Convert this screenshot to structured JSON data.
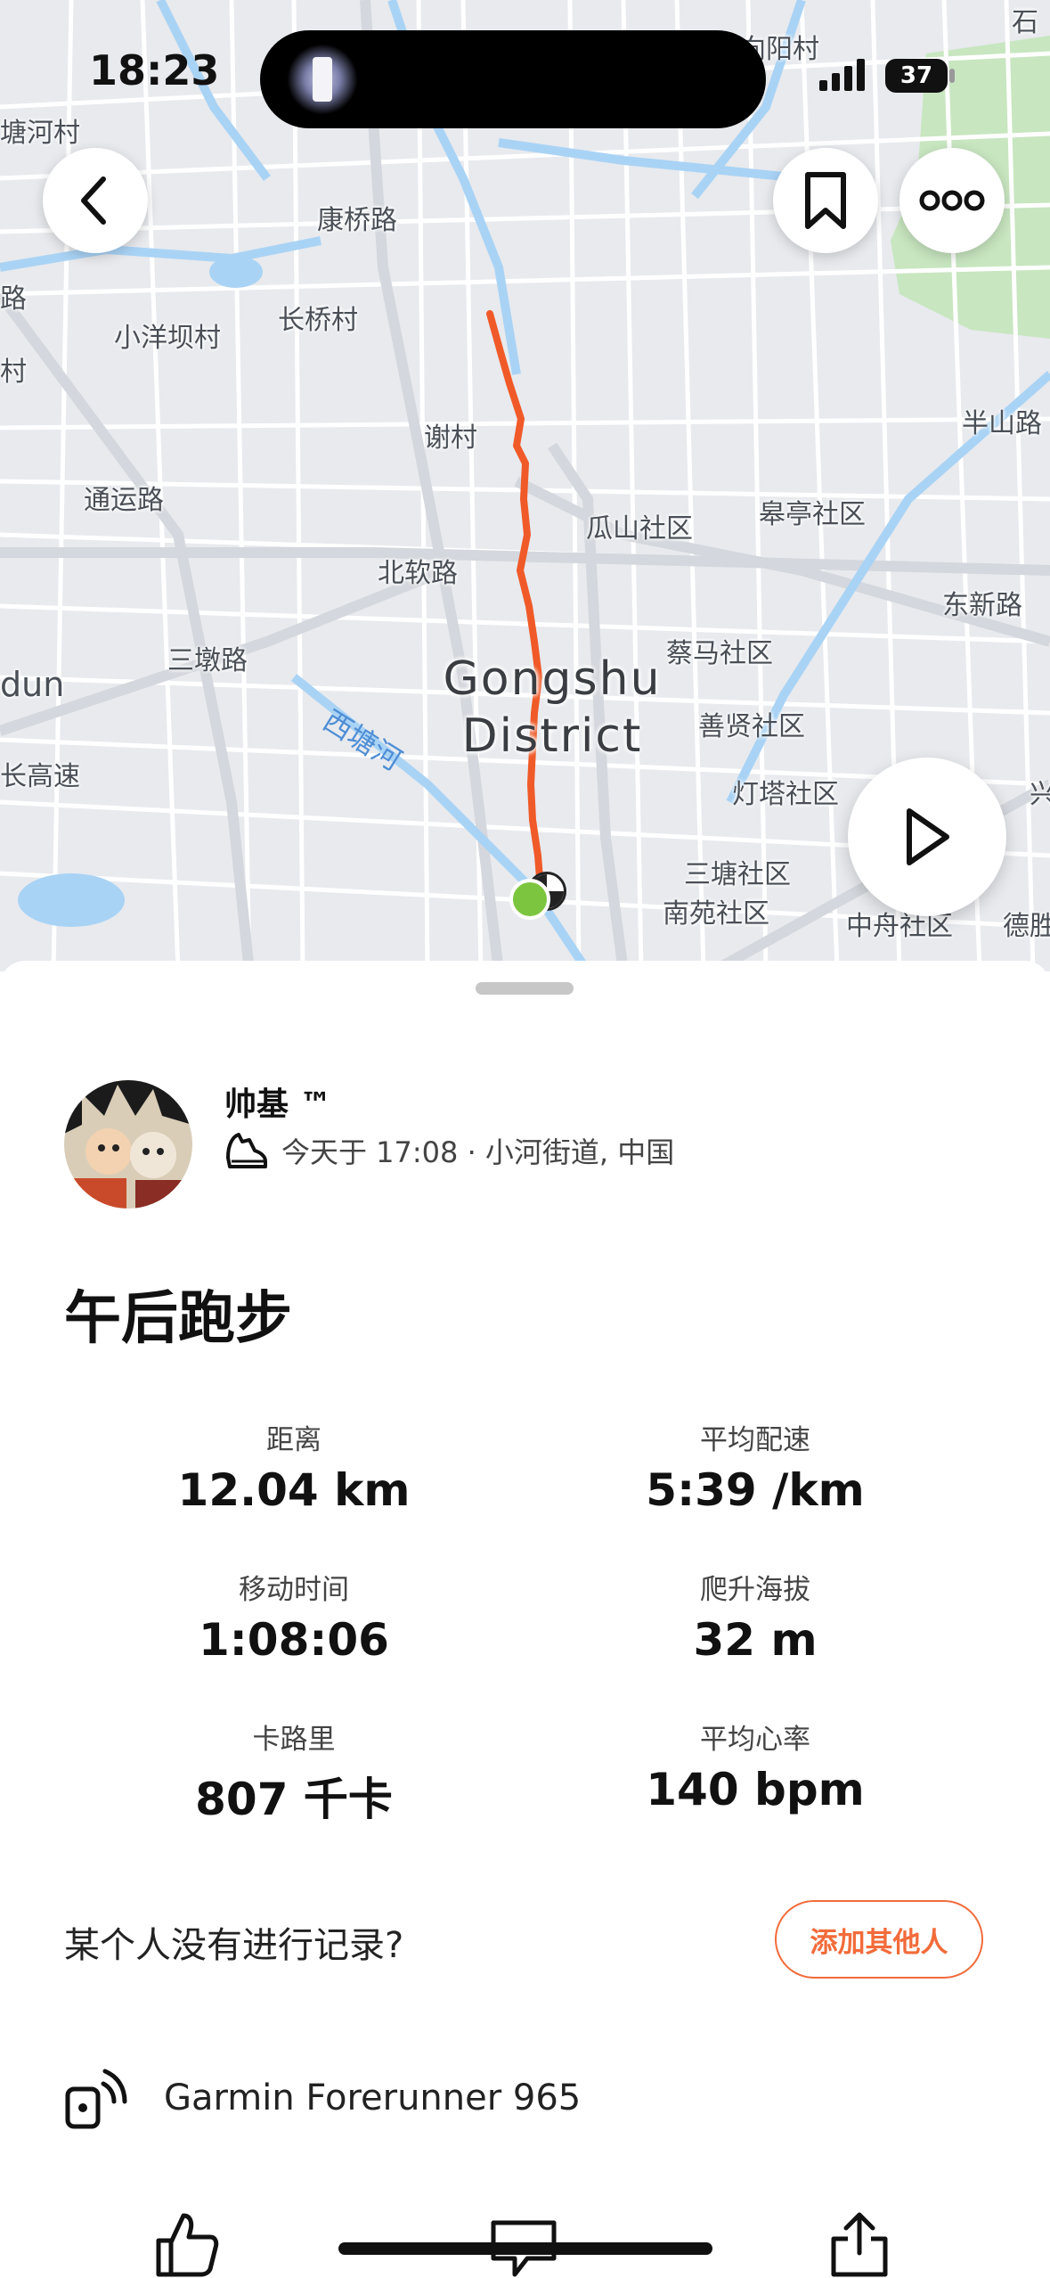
{
  "status_bar": {
    "time": "18:23",
    "battery": "37"
  },
  "map": {
    "labels": {
      "chaoyang": "向阳村",
      "tanghecun": "塘河村",
      "kangqiaolu": "康桥路",
      "lu_left": "路",
      "xiaoyangbacun": "小洋坝村",
      "changqiaocun": "长桥村",
      "cun_left": "村",
      "banshan": "半山路",
      "xiecun": "谢村",
      "tongyunlu": "通运路",
      "guashan": "瓜山社区",
      "gaoting": "皋亭社区",
      "beiruanlu": "北软路",
      "dongxinlu": "东新路",
      "sandunlu": "三墩路",
      "caima": "蔡马社区",
      "dun": "dun",
      "shanxian": "善贤社区",
      "changgaosu": "长高速",
      "dengta": "灯塔社区",
      "xing": "兴",
      "santang": "三塘社区",
      "nanyuan": "南苑社区",
      "zhongzhou": "中舟社区",
      "desheng": "德胜",
      "shi": "石"
    },
    "river_label": "西塘河",
    "district_line1": "Gongshu",
    "district_line2": "District",
    "colors": {
      "route": "#f05a28",
      "start_marker": "#7cc63f",
      "water": "#a9d3f5",
      "park": "#c8e6c0"
    }
  },
  "actions": {
    "back_icon": "chevron-left-icon",
    "bookmark_icon": "bookmark-icon",
    "more_icon": "more-dots-icon",
    "play_icon": "play-icon"
  },
  "activity": {
    "athlete_name": "帅基 ™",
    "sport_icon": "running-shoe-icon",
    "meta": "今天于 17:08 · 小河街道, 中国",
    "title": "午后跑步"
  },
  "stats": [
    {
      "label": "距离",
      "value": "12.04 km"
    },
    {
      "label": "平均配速",
      "value": "5:39 /km"
    },
    {
      "label": "移动时间",
      "value": "1:08:06"
    },
    {
      "label": "爬升海拔",
      "value": "32 m"
    },
    {
      "label": "卡路里",
      "value": "807 千卡"
    },
    {
      "label": "平均心率",
      "value": "140 bpm"
    }
  ],
  "group": {
    "prompt": "某个人没有进行记录?",
    "add_button": "添加其他人"
  },
  "device": {
    "icon": "device-sync-icon",
    "name": "Garmin Forerunner 965"
  },
  "bottom_bar": {
    "like_icon": "thumbs-up-icon",
    "comment_icon": "comment-icon",
    "share_icon": "share-icon"
  },
  "accent_color": "#f26b3a"
}
